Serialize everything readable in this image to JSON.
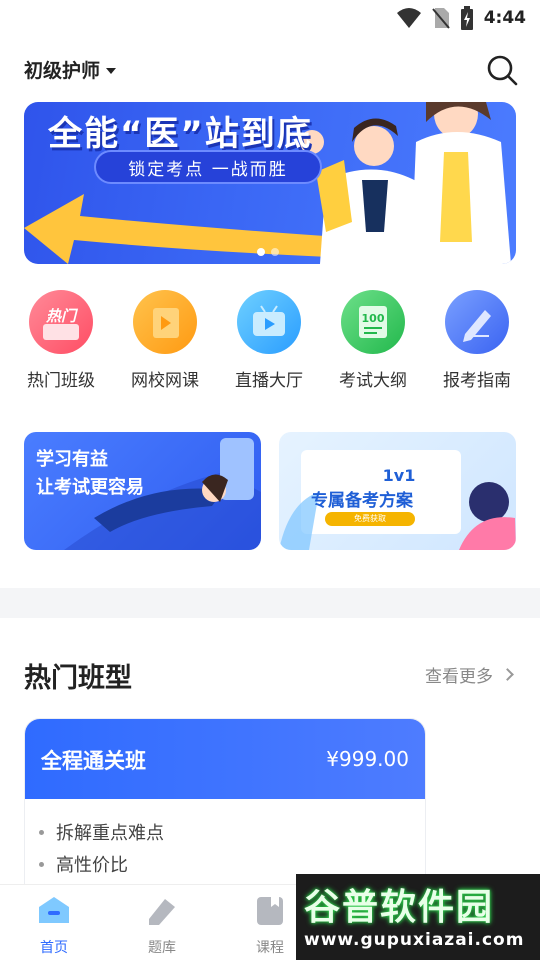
{
  "status_bar": {
    "time": "4:44"
  },
  "header": {
    "level": "初级护师"
  },
  "banner": {
    "title": "全能“医”站到底",
    "subtitle": "锁定考点  一战而胜"
  },
  "quick_entries": [
    {
      "label": "热门班级",
      "icon": "hot-class-icon",
      "badge": "热门",
      "color": "#ff5a6e"
    },
    {
      "label": "网校网课",
      "icon": "online-course-icon",
      "color": "#ffa21a"
    },
    {
      "label": "直播大厅",
      "icon": "live-hall-icon",
      "color": "#2fa8ff"
    },
    {
      "label": "考试大纲",
      "icon": "exam-outline-icon",
      "badge": "100",
      "color": "#2fc25b"
    },
    {
      "label": "报考指南",
      "icon": "registration-guide-icon",
      "color": "#3d6bff"
    }
  ],
  "promos": {
    "left": {
      "line1": "学习有益",
      "line2": "让考试更容易"
    },
    "right": {
      "title": "1v1",
      "subtitle": "专属备考方案",
      "button": "免费获取"
    }
  },
  "hot_classes": {
    "title": "热门班型",
    "more": "查看更多",
    "cards": [
      {
        "name": "全程通关班",
        "price": "¥999.00",
        "features": [
          "拆解重点难点",
          "高性价比"
        ]
      }
    ]
  },
  "bottom_nav": [
    {
      "label": "首页",
      "icon": "home-icon",
      "active": true
    },
    {
      "label": "题库",
      "icon": "question-bank-icon",
      "active": false
    },
    {
      "label": "课程",
      "icon": "course-icon",
      "active": false
    }
  ],
  "watermark": {
    "title": "谷普软件园",
    "url": "www.gupuxiazai.com"
  }
}
